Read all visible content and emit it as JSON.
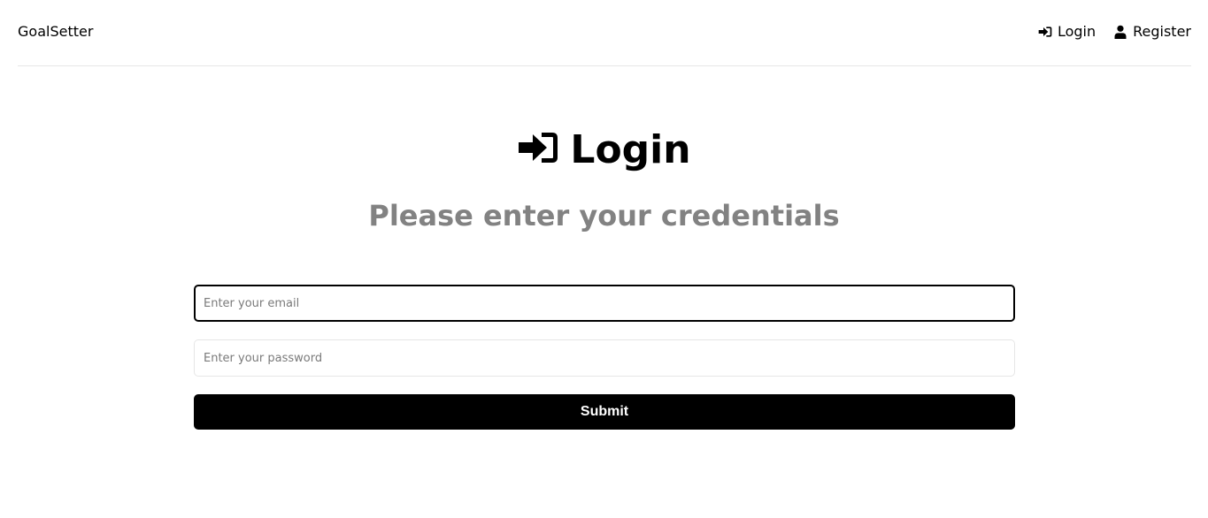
{
  "header": {
    "brand": "GoalSetter",
    "nav": [
      {
        "label": "Login",
        "icon": "sign-in-icon"
      },
      {
        "label": "Register",
        "icon": "user-icon"
      }
    ]
  },
  "main": {
    "heading": "Login",
    "heading_icon": "sign-in-icon",
    "subheading": "Please enter your credentials"
  },
  "form": {
    "email": {
      "value": "",
      "placeholder": "Enter your email"
    },
    "password": {
      "value": "",
      "placeholder": "Enter your password"
    },
    "submit_label": "Submit"
  },
  "colors": {
    "subheading": "#828282",
    "button_bg": "#000000",
    "button_text": "#ffffff",
    "border": "#e6e6e6"
  }
}
